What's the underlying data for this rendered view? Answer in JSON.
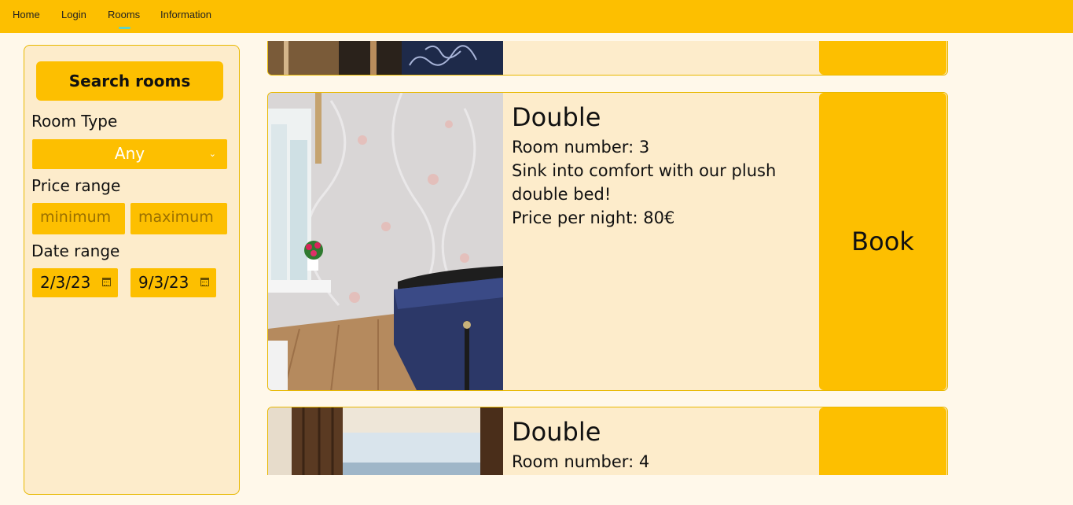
{
  "nav": {
    "items": [
      "Home",
      "Login",
      "Rooms",
      "Information"
    ],
    "active": "Rooms",
    "accent": "#5fd3c4"
  },
  "sidebar": {
    "search_label": "Search rooms",
    "room_type_label": "Room Type",
    "room_type_value": "Any",
    "price_label": "Price range",
    "min_placeholder": "minimum",
    "max_placeholder": "maximum",
    "date_label": "Date range",
    "date_from": "2/3/23",
    "date_to": "9/3/23"
  },
  "rooms": [
    {
      "type": "Double",
      "room_number": "Room number: 3",
      "description": "Sink into comfort with our plush double bed!",
      "price": "Price per night: 80€",
      "book_label": "Book"
    },
    {
      "type": "Double",
      "room_number": "Room number: 4"
    }
  ],
  "colors": {
    "brand": "#fdbf00",
    "card_bg": "#fdeccb",
    "page_bg": "#fff8ea"
  }
}
